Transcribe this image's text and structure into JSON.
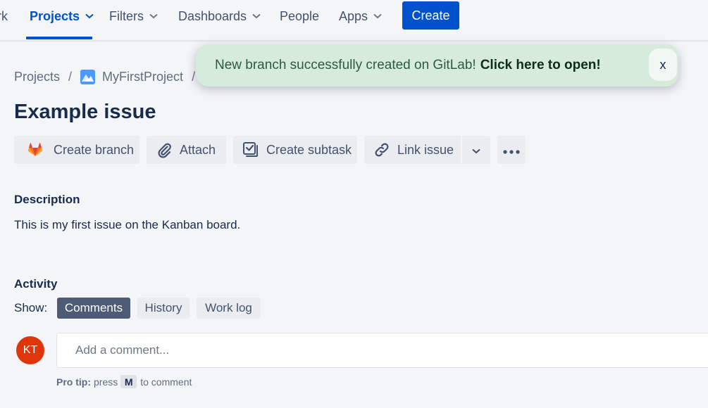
{
  "nav": {
    "truncated_left": "rk",
    "projects": "Projects",
    "filters": "Filters",
    "dashboards": "Dashboards",
    "people": "People",
    "apps": "Apps",
    "create": "Create"
  },
  "breadcrumb": {
    "projects": "Projects",
    "separator": "/",
    "project_name": "MyFirstProject"
  },
  "issue": {
    "title": "Example issue"
  },
  "actions": {
    "create_branch": "Create branch",
    "attach": "Attach",
    "create_subtask": "Create subtask",
    "link_issue": "Link issue"
  },
  "description": {
    "heading": "Description",
    "text": "This is my first issue on the Kanban board."
  },
  "activity": {
    "heading": "Activity",
    "show_label": "Show:",
    "tabs": [
      "Comments",
      "History",
      "Work log"
    ],
    "selected_tab": "Comments"
  },
  "comment": {
    "avatar_initials": "KT",
    "placeholder": "Add a comment...",
    "protip_label": "Pro tip:",
    "protip_press": "press",
    "protip_key": "M",
    "protip_suffix": "to comment"
  },
  "toast": {
    "message": "New branch successfully created on GitLab!",
    "link": "Click here to open!",
    "close": "x"
  },
  "colors": {
    "brand_blue": "#0052cc",
    "toast_bg": "#d6ebdb",
    "avatar_bg": "#de350b",
    "selected_tab_bg": "#4d5b75"
  }
}
